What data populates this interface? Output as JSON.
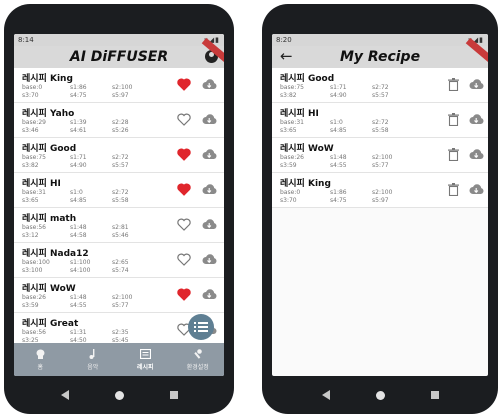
{
  "left_screen": {
    "status_time": "8:14",
    "status_icons": "▾◢▮",
    "app_title": "AI DiFFUSER",
    "items": [
      {
        "name": "레시피 King",
        "base": "base:0",
        "s1": "s1:86",
        "s2": "s2:100",
        "s3": "s3:70",
        "s4": "s4:75",
        "s5": "s5:97",
        "favorite": true
      },
      {
        "name": "레시피 Yaho",
        "base": "base:29",
        "s1": "s1:39",
        "s2": "s2:28",
        "s3": "s3:46",
        "s4": "s4:61",
        "s5": "s5:26",
        "favorite": false
      },
      {
        "name": "레시피 Good",
        "base": "base:75",
        "s1": "s1:71",
        "s2": "s2:72",
        "s3": "s3:82",
        "s4": "s4:90",
        "s5": "s5:57",
        "favorite": true
      },
      {
        "name": "레시피 HI",
        "base": "base:31",
        "s1": "s1:0",
        "s2": "s2:72",
        "s3": "s3:65",
        "s4": "s4:85",
        "s5": "s5:58",
        "favorite": true
      },
      {
        "name": "레시피 math",
        "base": "base:56",
        "s1": "s1:48",
        "s2": "s2:81",
        "s3": "s3:12",
        "s4": "s4:58",
        "s5": "s5:46",
        "favorite": false
      },
      {
        "name": "레시피 Nada12",
        "base": "base:100",
        "s1": "s1:100",
        "s2": "s2:65",
        "s3": "s3:100",
        "s4": "s4:100",
        "s5": "s5:74",
        "favorite": false
      },
      {
        "name": "레시피 WoW",
        "base": "base:26",
        "s1": "s1:48",
        "s2": "s2:100",
        "s3": "s3:59",
        "s4": "s4:55",
        "s5": "s5:77",
        "favorite": true
      },
      {
        "name": "레시피 Great",
        "base": "base:56",
        "s1": "s1:31",
        "s2": "s2:35",
        "s3": "s3:25",
        "s4": "s4:50",
        "s5": "s5:45",
        "favorite": false
      }
    ],
    "nav": [
      {
        "label": "홈",
        "icon": "home-icon"
      },
      {
        "label": "음악",
        "icon": "music-icon"
      },
      {
        "label": "레시피",
        "icon": "recipe-icon",
        "active": true
      },
      {
        "label": "환경설정",
        "icon": "settings-icon"
      }
    ]
  },
  "right_screen": {
    "status_time": "8:20",
    "status_icons": "▾◢▮",
    "app_title": "My Recipe",
    "back_glyph": "←",
    "items": [
      {
        "name": "레시피 Good",
        "base": "base:75",
        "s1": "s1:71",
        "s2": "s2:72",
        "s3": "s3:82",
        "s4": "s4:90",
        "s5": "s5:57"
      },
      {
        "name": "레시피 HI",
        "base": "base:31",
        "s1": "s1:0",
        "s2": "s2:72",
        "s3": "s3:65",
        "s4": "s4:85",
        "s5": "s5:58"
      },
      {
        "name": "레시피 WoW",
        "base": "base:26",
        "s1": "s1:48",
        "s2": "s2:100",
        "s3": "s3:59",
        "s4": "s4:55",
        "s5": "s5:77"
      },
      {
        "name": "레시피 King",
        "base": "base:0",
        "s1": "s1:86",
        "s2": "s2:100",
        "s3": "s3:70",
        "s4": "s4:75",
        "s5": "s5:97"
      }
    ]
  },
  "colors": {
    "favorite": "#e0262c",
    "nav": "#8f9aa4",
    "fab": "#5f7f93",
    "appbar": "#d9d9d9"
  }
}
